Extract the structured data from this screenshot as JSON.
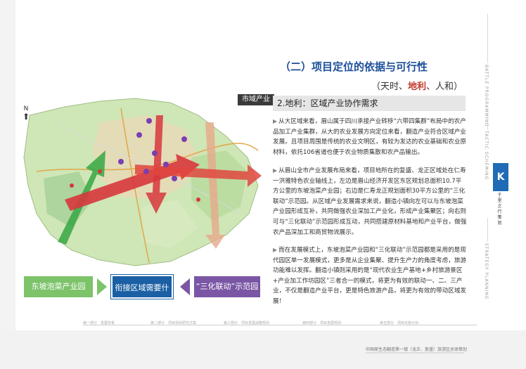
{
  "map": {
    "label": "市域产业",
    "north": "N"
  },
  "boxes": {
    "left": "东坡泡菜产业园",
    "center": "衔接区域需要什么?",
    "right": "“三化联动”示范园"
  },
  "header": {
    "title": "（二）项目定位的依据与可行性",
    "subtitle_pre": "（天时、",
    "subtitle_highlight": "地利",
    "subtitle_post": "、人和）"
  },
  "section": {
    "heading": "2.地利：区域产业协作需求",
    "paragraphs": [
      "从大区域来看，眉山属于四川承接产业转移“六带四集群”布局中的农产品加工产业集群，从大的农业发展方向定位来看，翻造产业符合区域产业发展。且项目周围是传统的农业文明区，有较为发达的农业基础和农业原材料，依托106省道也便于农业物质集散和农产品输出。",
      "从眉山全市产业发展布局来看，项目地所在的复盛、龙正区域处在仁寿一洪雅特色农业轴线上，左边是眉山经济开发区东区规划总面积10.7平方公里的东坡泡菜产业园；右边是仁寿龙正规划面积30平方公里的“三化联动”示范园。从区域产业发展需求来说，翻造小镇向左可以与东坡泡菜产业园形成互补，共同做强农业深加工产业化，形成产业集聚区；向右则可与“三化联动”示范园形成互动，共同搭建原材料基地和产业平台，做强农产品深加工和商贸物流展示。",
      "而在发展模式上，东坡泡菜产业园和“三化联动”示范园都是采用的是现代园区单一发展模式，更多是从企业集聚、提升生产力的角度考虑，旅游功能难以发挥。翻造小镇则采用的是“现代农业生产基地+乡村旅游景区+产业加工作坊园区”三者合一的模式，将更为有效的联动一、二、三产业，不仅是翻造产业平台，更是特色旅游产品，将更为有效的带动区域发展！"
    ]
  },
  "sidebar": {
    "v1": "BATTLE PROGRAMMING",
    "v2": "TACTIC SCHEMING",
    "v3": "STRATEGY PLANNING",
    "logo": "K",
    "logo_text": "千 里 之 行 策 划"
  },
  "footer": {
    "steps": [
      "第一部分　发展背景",
      "第二部分　项目现状研究方案",
      "第三部分　项目发展战略规划",
      "第四部分　项目发展规划",
      "第五部分　项目实施计划"
    ],
    "doc_title": "中国原生态翻造第一镇（龙正、复盛）旅游区总体策划"
  },
  "colors": {
    "green": "#7cc36a",
    "blue": "#1b5fa4",
    "purple": "#7a56a5",
    "title_blue": "#1d4f9a",
    "highlight_red": "#c0392b"
  }
}
